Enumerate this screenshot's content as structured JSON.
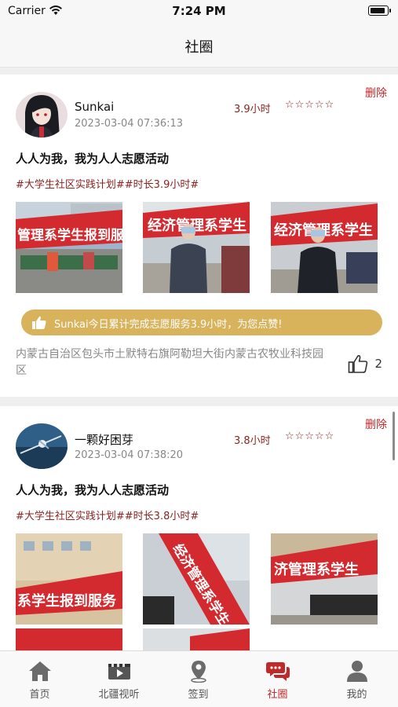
{
  "status_bar": {
    "carrier": "Carrier",
    "time": "7:24 PM",
    "battery_level": 0.8
  },
  "nav": {
    "title": "社圈"
  },
  "posts": [
    {
      "username": "Sunkai",
      "time": "2023-03-04 07:36:13",
      "hours": "3.9小时",
      "stars": "☆☆☆☆☆",
      "delete_label": "删除",
      "title": "人人为我，我为人人志愿活动",
      "tags": "#大学生社区实践计划##时长3.9小时#",
      "photo_texts": [
        "管理系学生报到服务",
        "经济管理系学生",
        "经济管理系学生"
      ],
      "praise": "Sunkai今日累计完成志愿服务3.9小时，为您点赞!",
      "address": "内蒙古自治区包头市土默特右旗阿勒坦大街内蒙古农牧业科技园区",
      "likes": "2"
    },
    {
      "username": "一颗好困芽",
      "time": "2023-03-04 07:38:20",
      "hours": "3.8小时",
      "stars": "☆☆☆☆☆",
      "delete_label": "删除",
      "title": "人人为我，我为人人志愿活动",
      "tags": "#大学生社区实践计划##时长3.8小时#",
      "photo_texts": [
        "系学生报到服务",
        "经济管理系学生",
        "济管理系学生"
      ]
    }
  ],
  "tabs": [
    {
      "label": "首页",
      "icon": "home-icon"
    },
    {
      "label": "北疆视听",
      "icon": "video-icon"
    },
    {
      "label": "签到",
      "icon": "location-pin-icon"
    },
    {
      "label": "社圈",
      "icon": "chat-bubbles-icon",
      "active": true
    },
    {
      "label": "我的",
      "icon": "person-icon"
    }
  ],
  "colors": {
    "accent": "#c0282a",
    "dark_red": "#8b2420",
    "gold": "#d9b25c",
    "banner_red": "#d32a2f"
  }
}
